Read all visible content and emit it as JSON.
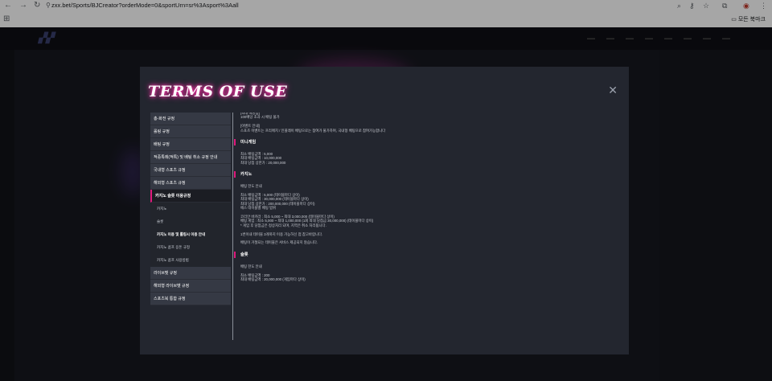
{
  "browser": {
    "url": "zxx.bet/Sports/BJCreator?orderMode=0&sportUrn=sr%3Asport%3Aall",
    "bookmarks_folder": "모든 북마크"
  },
  "modal": {
    "title": "TERMS OF USE",
    "menu": [
      {
        "label": "총-화전 규정"
      },
      {
        "label": "롤링 규정"
      },
      {
        "label": "배팅 규정"
      },
      {
        "label": "적중특례(적특) 및 배팅 취소 규정 안내"
      },
      {
        "label": "국내형 스포츠 규정"
      },
      {
        "label": "해외형 스포츠 규정"
      },
      {
        "label": "카지노 슬롯 이용규정"
      }
    ],
    "submenu": [
      {
        "label": "카지노"
      },
      {
        "label": "슬롯"
      },
      {
        "label": "카지노 이용 및 롤링시 이용 안내"
      },
      {
        "label": "카지노 콤프 응돈 규정"
      },
      {
        "label": "카지노 콤프 사용방법"
      }
    ],
    "menu_bottom": [
      {
        "label": "라이브벳 규정"
      },
      {
        "label": "해외형 라이브벳 규정"
      },
      {
        "label": "스포츠북 통합 규정"
      }
    ],
    "content": {
      "intro": [
        "[최대 배당금]",
        "100배당 초과 시 배팅 불가",
        "",
        "[이벤트 안내]",
        "스포츠 이벤트는 프리매치 / 인플레이 배팅으로는 참여가 불가하며, 국내형 배팅으로 참여가능합니다"
      ],
      "minigame_title": "미니게임",
      "minigame": [
        "최소 배팅금액 : 5,000",
        "최대 배팅금액 : 10,000,000",
        "최대 당첨 상한가 : 20,000,000"
      ],
      "casino_title": "카지노",
      "casino": [
        "배팅 한도 안내",
        "",
        "최소 배팅금액 : 5,000 (테이블마다 상이)",
        "최대 배팅금액 : 30,000,000 (테이블마다 상이)",
        "최대 당첨 상한가 : 200,000,000 (테이블마다 상이)",
        "에스 테이블별 배팅 범위",
        "",
        "코리안 바카라 : 최소 5,000 ~ 최대 3,000,000 (테이블마다 상이)",
        "베팅 게임 : 최소 5,000 ~ 최대 1,000,000 (1회 최대 당첨금 30,000,000) (테이블마다 상이)",
        "* 게임 후 당첨금은 정상처리 되며, 지역은 취소 처리됩니다.",
        "",
        "1번이내 테이블 3개까지 이용 가능하신 점 참고바랍니다.",
        "",
        "배팅이 거절되는 테이블은 서비스 제공되지 않습니다."
      ],
      "slot_title": "슬롯",
      "slot": [
        "배팅 한도 안내",
        "",
        "최소 배팅금액 : 200",
        "최대 배팅금액 : 20,000,000 (게임마다 상이)"
      ]
    }
  }
}
